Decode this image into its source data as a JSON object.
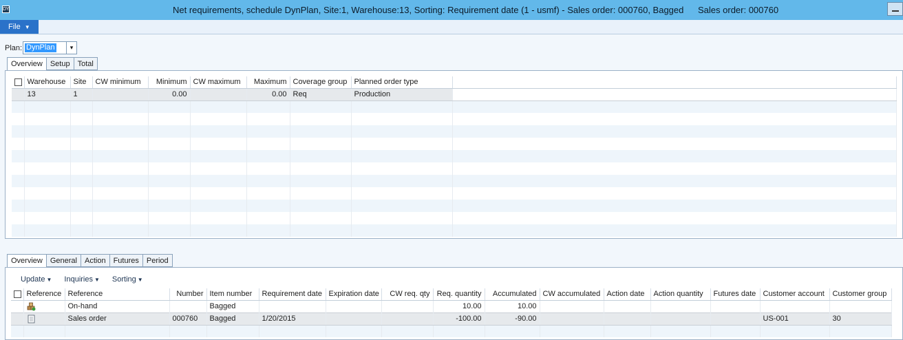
{
  "window": {
    "title": "Net requirements, schedule DynPlan, Site:1, Warehouse:13, Sorting: Requirement date (1 - usmf) - Sales order: 000760, Bagged",
    "title_extra": "Sales order: 000760",
    "app_icon": "DY",
    "minimize_icon": "minimize-icon"
  },
  "menu": {
    "file_label": "File",
    "file_caret": "▼"
  },
  "plan": {
    "label": "Plan:",
    "value": "DynPlan",
    "dropdown_glyph": "▾"
  },
  "top_tabs": [
    {
      "label": "Overview",
      "active": true
    },
    {
      "label": "Setup",
      "active": false
    },
    {
      "label": "Total",
      "active": false
    }
  ],
  "coverage_grid": {
    "columns": [
      "Warehouse",
      "Site",
      "CW minimum",
      "Minimum",
      "CW maximum",
      "Maximum",
      "Coverage group",
      "Planned order type"
    ],
    "rows": [
      {
        "warehouse": "13",
        "site": "1",
        "cw_minimum": "",
        "minimum": "0.00",
        "cw_maximum": "",
        "maximum": "0.00",
        "coverage_group": "Req",
        "planned_order_type": "Production"
      }
    ]
  },
  "bottom_tabs": [
    {
      "label": "Overview",
      "active": true
    },
    {
      "label": "General",
      "active": false
    },
    {
      "label": "Action",
      "active": false
    },
    {
      "label": "Futures",
      "active": false
    },
    {
      "label": "Period",
      "active": false
    }
  ],
  "toolbar": {
    "update": "Update",
    "inquiries": "Inquiries",
    "sorting": "Sorting",
    "caret": "▼"
  },
  "transactions_grid": {
    "columns": [
      "Reference",
      "Reference",
      "Number",
      "Item number",
      "Requirement date",
      "Expiration date",
      "CW req. qty",
      "Req. quantity",
      "Accumulated",
      "CW accumulated",
      "Action date",
      "Action quantity",
      "Futures date",
      "Customer account",
      "Customer group"
    ],
    "rows": [
      {
        "icon": "warehouse-stock-icon",
        "reference": "On-hand",
        "number": "",
        "item_number": "Bagged",
        "requirement_date": "",
        "expiration_date": "",
        "cw_req_qty": "",
        "req_quantity": "10.00",
        "accumulated": "10.00",
        "cw_accumulated": "",
        "action_date": "",
        "action_quantity": "",
        "futures_date": "",
        "customer_account": "",
        "customer_group": ""
      },
      {
        "icon": "document-icon",
        "reference": "Sales order",
        "number": "000760",
        "item_number": "Bagged",
        "requirement_date": "1/20/2015",
        "expiration_date": "",
        "cw_req_qty": "",
        "req_quantity": "-100.00",
        "accumulated": "-90.00",
        "cw_accumulated": "",
        "action_date": "",
        "action_quantity": "",
        "futures_date": "",
        "customer_account": "US-001",
        "customer_group": "30"
      }
    ]
  }
}
